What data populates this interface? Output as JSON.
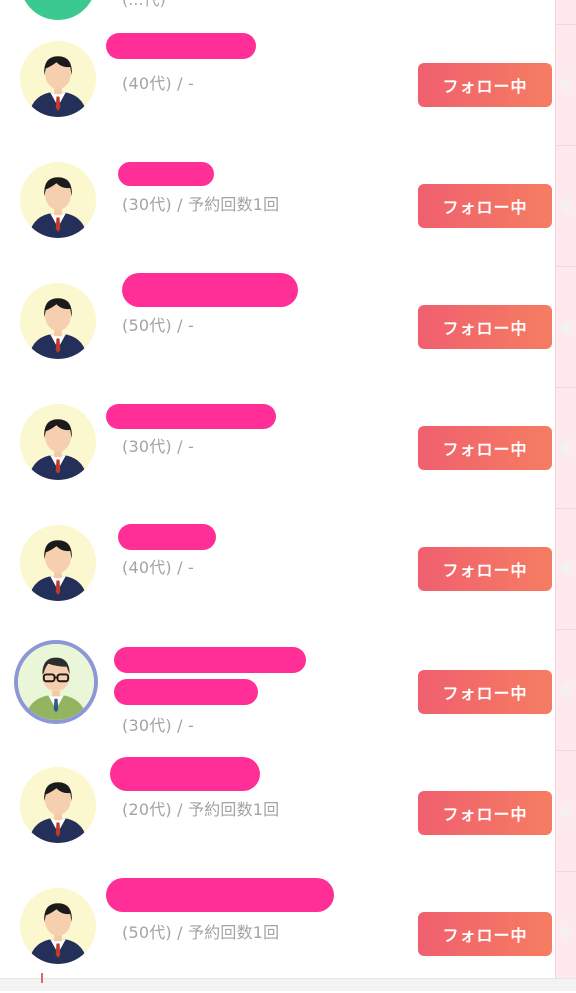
{
  "top_partial": {
    "meta": "(...代)"
  },
  "users": [
    {
      "meta": "(40代) / -",
      "button": "フォロー中",
      "avatar": "businessman-avatar-icon"
    },
    {
      "meta": "(30代) / 予約回数1回",
      "button": "フォロー中",
      "avatar": "businessman-avatar-icon"
    },
    {
      "meta": "(50代) / -",
      "button": "フォロー中",
      "avatar": "businessman-avatar-icon"
    },
    {
      "meta": "(30代) / -",
      "button": "フォロー中",
      "avatar": "businessman-avatar-icon"
    },
    {
      "meta": "(40代) / -",
      "button": "フォロー中",
      "avatar": "businessman-avatar-icon"
    },
    {
      "meta": "(30代) / -",
      "button": "フォロー中",
      "avatar": "glasses-man-avatar-icon"
    },
    {
      "meta": "(20代) / 予約回数1回",
      "button": "フォロー中",
      "avatar": "businessman-avatar-icon"
    },
    {
      "meta": "(50代) / 予約回数1回",
      "button": "フォロー中",
      "avatar": "businessman-avatar-icon"
    }
  ],
  "colors": {
    "follow_button_start": "#f05f6f",
    "follow_button_end": "#f57d61",
    "redaction": "#ff2f97",
    "meta_text": "#a3a3a3",
    "avatar_bg": "#fbf8cf"
  }
}
